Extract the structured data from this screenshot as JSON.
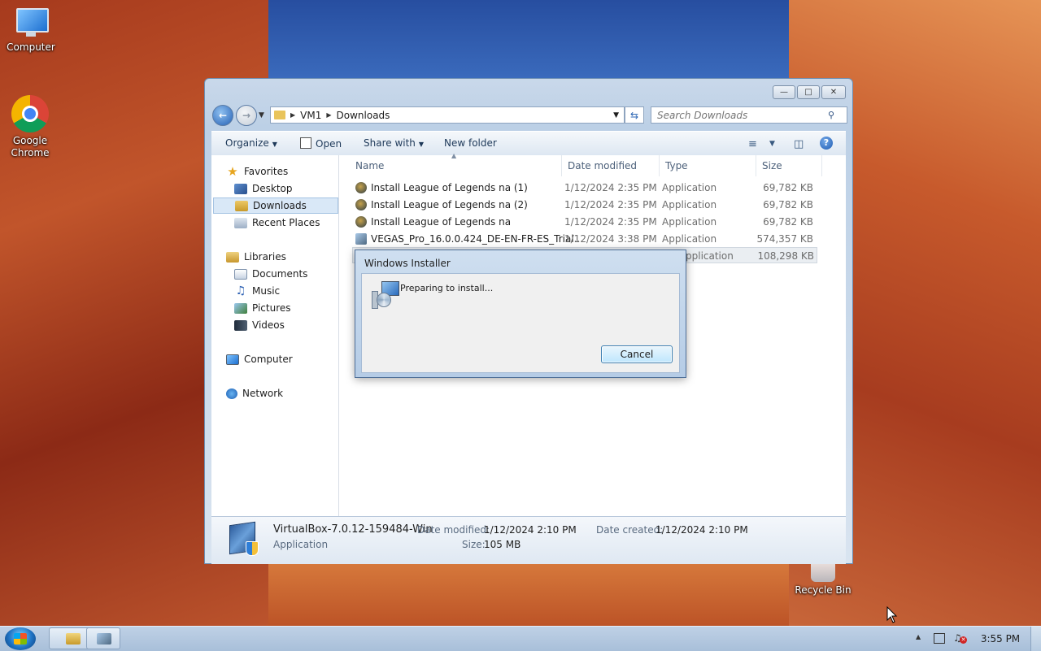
{
  "desktop": {
    "icons": [
      {
        "label": "Computer"
      },
      {
        "label": "Google Chrome"
      },
      {
        "label": "Recycle Bin"
      }
    ]
  },
  "explorer": {
    "address": {
      "crumbs": [
        "VM1",
        "Downloads"
      ]
    },
    "search": {
      "placeholder": "Search Downloads"
    },
    "toolbar": {
      "organize": "Organize",
      "open": "Open",
      "share_with": "Share with",
      "new_folder": "New folder"
    },
    "nav": {
      "favorites": "Favorites",
      "desktop": "Desktop",
      "downloads": "Downloads",
      "recent": "Recent Places",
      "libraries": "Libraries",
      "documents": "Documents",
      "music": "Music",
      "pictures": "Pictures",
      "videos": "Videos",
      "computer": "Computer",
      "network": "Network"
    },
    "columns": {
      "name": "Name",
      "date": "Date modified",
      "type": "Type",
      "size": "Size"
    },
    "files": [
      {
        "name": "Install League of Legends na (1)",
        "date": "1/12/2024 2:35 PM",
        "type": "Application",
        "size": "69,782 KB"
      },
      {
        "name": "Install League of Legends na (2)",
        "date": "1/12/2024 2:35 PM",
        "type": "Application",
        "size": "69,782 KB"
      },
      {
        "name": "Install League of Legends na",
        "date": "1/12/2024 2:35 PM",
        "type": "Application",
        "size": "69,782 KB"
      },
      {
        "name": "VEGAS_Pro_16.0.0.424_DE-EN-FR-ES_Trial...",
        "date": "1/12/2024 3:38 PM",
        "type": "Application",
        "size": "574,357 KB"
      },
      {
        "name": "",
        "date": "",
        "type": "pplication",
        "size": "108,298 KB"
      }
    ],
    "details": {
      "filename": "VirtualBox-7.0.12-159484-Win",
      "kind": "Application",
      "date_modified_label": "Date modified:",
      "date_modified": "1/12/2024 2:10 PM",
      "size_label": "Size:",
      "size": "105 MB",
      "date_created_label": "Date created:",
      "date_created": "1/12/2024 2:10 PM"
    }
  },
  "installer": {
    "title": "Windows Installer",
    "message": "Preparing to install...",
    "cancel": "Cancel"
  },
  "taskbar": {
    "clock": "3:55 PM"
  }
}
